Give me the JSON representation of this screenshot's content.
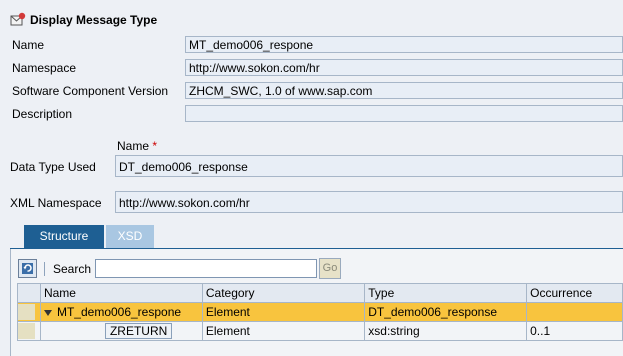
{
  "header": {
    "title": "Display Message Type",
    "icon": "message-type-icon"
  },
  "form": {
    "name_label": "Name",
    "name_value": "MT_demo006_respone",
    "namespace_label": "Namespace",
    "namespace_value": "http://www.sokon.com/hr",
    "swc_label": "Software Component Version",
    "swc_value": "ZHCM_SWC, 1.0 of www.sap.com",
    "description_label": "Description",
    "description_value": "",
    "dt_name_header": "Name",
    "dt_required_mark": "*",
    "data_type_used_label": "Data Type Used",
    "data_type_used_value": "DT_demo006_response",
    "xml_namespace_label": "XML Namespace",
    "xml_namespace_value": "http://www.sokon.com/hr"
  },
  "tabs": [
    {
      "label": "Structure",
      "active": true
    },
    {
      "label": "XSD",
      "active": false
    }
  ],
  "toolbar": {
    "search_label": "Search",
    "search_value": "",
    "go_label": "Go"
  },
  "table": {
    "columns": [
      "Name",
      "Category",
      "Type",
      "Occurrence"
    ],
    "rows": [
      {
        "name": "MT_demo006_respone",
        "category": "Element",
        "type": "DT_demo006_response",
        "occurrence": "",
        "selected": true,
        "expanded": true
      },
      {
        "name": "ZRETURN",
        "category": "Element",
        "type": "xsd:string",
        "occurrence": "0..1",
        "selected": false
      }
    ]
  },
  "colors": {
    "tab_active": "#1e5f93",
    "tab_inactive": "#a9c7e2",
    "selected_row": "#f8c43e",
    "field_bg": "#e8eef6"
  }
}
